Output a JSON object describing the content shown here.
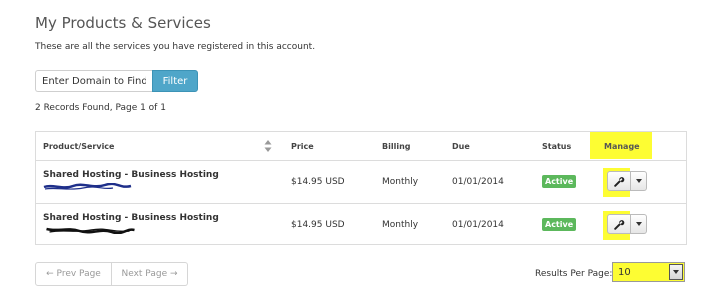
{
  "page": {
    "title": "My Products & Services",
    "subtitle": "These are all the services you have registered in this account.",
    "records_info": "2 Records Found, Page 1 of 1"
  },
  "filter": {
    "placeholder": "Enter Domain to Find",
    "button_label": "Filter"
  },
  "table": {
    "headers": {
      "product": "Product/Service",
      "price": "Price",
      "billing": "Billing",
      "due": "Due",
      "status": "Status",
      "manage": "Manage"
    },
    "rows": [
      {
        "product": "Shared Hosting - Business Hosting",
        "price": "$14.95 USD",
        "billing": "Monthly",
        "due": "01/01/2014",
        "status": "Active"
      },
      {
        "product": "Shared Hosting - Business Hosting",
        "price": "$14.95 USD",
        "billing": "Monthly",
        "due": "01/01/2014",
        "status": "Active"
      }
    ]
  },
  "pagination": {
    "prev_label": "← Prev Page",
    "next_label": "Next Page →"
  },
  "results_per_page": {
    "label": "Results Per Page:",
    "value": "10"
  },
  "icons": {
    "sort": "sort-icon",
    "manage": "wrench-icon",
    "dropdown": "caret-down-icon"
  },
  "colors": {
    "accent": "#4fa6c9",
    "active_badge": "#5cb85c",
    "highlight": "#fdfd33"
  }
}
